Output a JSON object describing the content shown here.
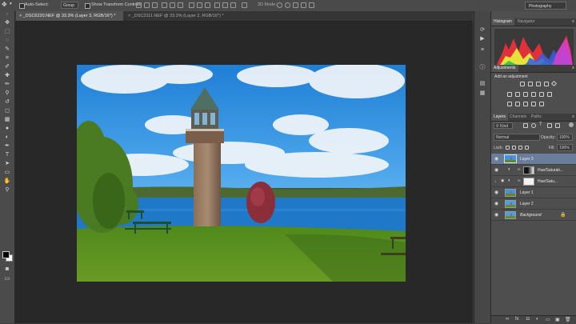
{
  "options_bar": {
    "auto_select_label": "Auto-Select:",
    "auto_select_target": "Group",
    "show_transform_label": "Show Transform Controls",
    "mode_3d_label": "3D Mode:",
    "workspace": "Photography"
  },
  "tabs": [
    {
      "label": "_DSC6220.NEF @ 33.3% (Layer 3, RGB/16*) *",
      "active": true
    },
    {
      "label": "_DSC3111.NEF @ 33.3% (Layer 2, RGB/16*) *",
      "active": false
    }
  ],
  "tools": [
    "move-tool",
    "marquee-tool",
    "lasso-tool",
    "quick-select-tool",
    "crop-tool",
    "eyedropper-tool",
    "healing-tool",
    "brush-tool",
    "clone-stamp-tool",
    "history-brush-tool",
    "eraser-tool",
    "gradient-tool",
    "blur-tool",
    "dodge-tool",
    "pen-tool",
    "type-tool",
    "path-select-tool",
    "shape-tool",
    "hand-tool",
    "zoom-tool"
  ],
  "tool_glyphs": [
    "✥",
    "⬚",
    "◌",
    "✎",
    "⌗",
    "✐",
    "✚",
    "✏",
    "⚲",
    "↺",
    "◻",
    "▦",
    "●",
    "◐",
    "✒",
    "T",
    "➤",
    "▭",
    "✋",
    "⚲"
  ],
  "histogram_panel": {
    "tabs": [
      {
        "label": "Histogram",
        "active": true
      },
      {
        "label": "Navigator",
        "active": false
      }
    ]
  },
  "adjustments_panel": {
    "tab": "Adjustments",
    "title": "Add an adjustment"
  },
  "layers_panel": {
    "tabs": [
      {
        "label": "Layers",
        "active": true
      },
      {
        "label": "Channels",
        "active": false
      },
      {
        "label": "Paths",
        "active": false
      }
    ],
    "filter_kind": "Kind",
    "blend_mode": "Normal",
    "opacity_label": "Opacity:",
    "opacity_value": "100%",
    "lock_label": "Lock:",
    "fill_label": "Fill:",
    "fill_value": "100%",
    "layers": [
      {
        "name": "Layer 3",
        "selected": true,
        "type": "pixel",
        "italic": false
      },
      {
        "name": "Hue/Saturati...",
        "selected": false,
        "type": "adjustment-bw",
        "italic": false
      },
      {
        "name": "Hue/Satu...",
        "selected": false,
        "type": "adjustment-white",
        "italic": false
      },
      {
        "name": "Layer 1",
        "selected": false,
        "type": "pixel",
        "italic": false
      },
      {
        "name": "Layer 2",
        "selected": false,
        "type": "pixel",
        "italic": false
      },
      {
        "name": "Background",
        "selected": false,
        "type": "background",
        "italic": true
      }
    ]
  },
  "colors": {
    "selected_layer": "#6a7e9c",
    "panel_bg": "#4e4e4e",
    "canvas_bg": "#282828"
  }
}
